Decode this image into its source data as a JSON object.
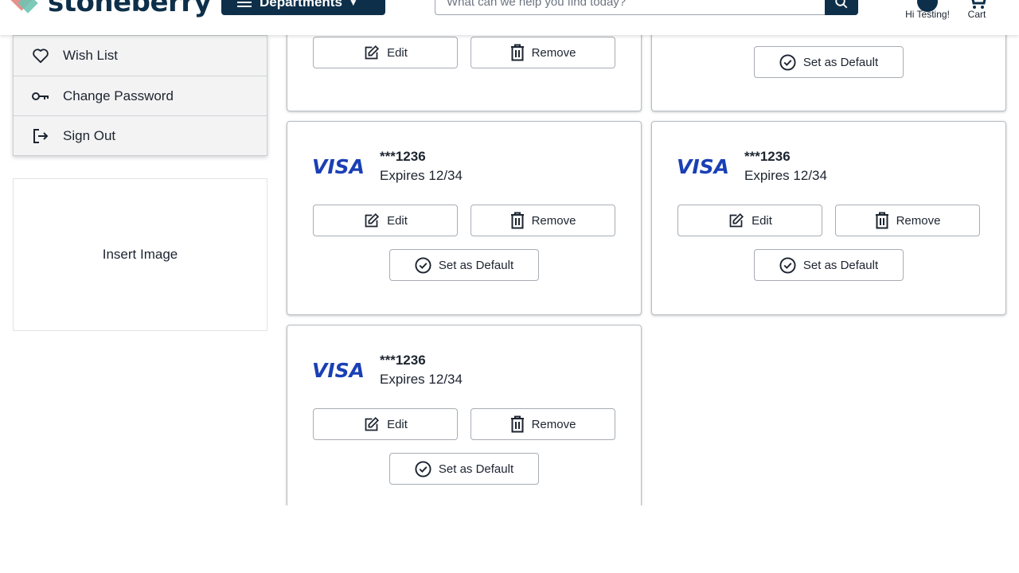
{
  "header": {
    "logo_text": "stoneberry",
    "departments_label": "Departments",
    "search_placeholder": "What can we help you find today?",
    "account_label": "Hi Testing!",
    "cart_label": "Cart"
  },
  "sidebar": {
    "items": [
      {
        "label": "Wish List",
        "icon": "heart-icon"
      },
      {
        "label": "Change Password",
        "icon": "key-icon"
      },
      {
        "label": "Sign Out",
        "icon": "sign-out-icon"
      }
    ],
    "image_placeholder": "Insert Image"
  },
  "buttons": {
    "edit": "Edit",
    "remove": "Remove",
    "set_default": "Set as Default"
  },
  "cards": [
    {
      "brand": "VISA",
      "number": "***1236",
      "expires": "Expires 12/34"
    },
    {
      "brand": "VISA",
      "number": "***1236",
      "expires": "Expires 12/34"
    },
    {
      "brand": "VISA",
      "number": "***1236",
      "expires": "Expires 12/34"
    }
  ],
  "colors": {
    "brand_navy": "#0d2f4a",
    "visa_blue": "#1a3fb5",
    "logo_pink": "#e98f8a",
    "logo_teal": "#6fc3b2"
  }
}
